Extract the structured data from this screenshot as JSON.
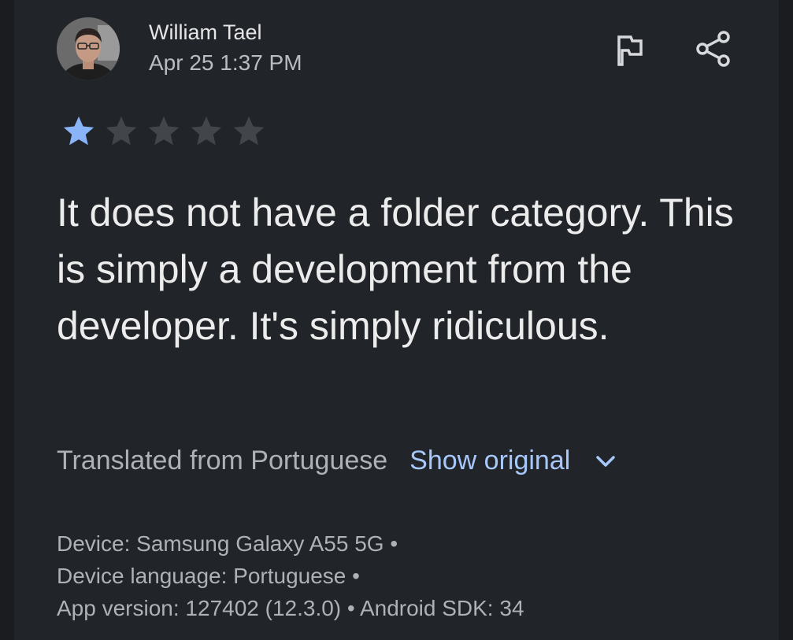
{
  "review": {
    "author": "William Tael",
    "date": "Apr 25 1:37 PM",
    "rating": 1,
    "max_rating": 5,
    "text": "It does not have a folder category. This is simply a development from the developer. It's simply ridiculous.",
    "translated_label": "Translated from Portuguese",
    "show_original_label": "Show original",
    "device_line": "Device: Samsung Galaxy A55 5G •",
    "language_line": "Device language: Portuguese •",
    "version_line": "App version: 127402 (12.3.0) • Android SDK: 34"
  },
  "icons": {
    "flag": "flag-icon",
    "share": "share-icon",
    "expand": "chevron-down-icon"
  },
  "colors": {
    "background": "#212428",
    "accent": "#a8c7fa",
    "star_filled": "#8ab4f8",
    "star_empty": "#42464b"
  }
}
